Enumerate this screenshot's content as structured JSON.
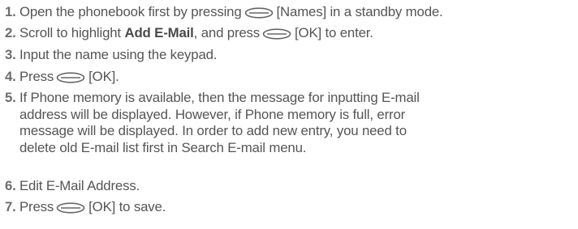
{
  "steps": [
    {
      "number": "1.",
      "before": "Open the phonebook first by pressing",
      "key_icon": "soft-key-left-icon",
      "after": "[Names] in a standby mode."
    },
    {
      "number": "2.",
      "before": "Scroll to highlight ",
      "bold": "Add E-Mail",
      "middle": ", and press",
      "key_icon": "ok-key-icon",
      "after": "[OK] to enter."
    },
    {
      "number": "3.",
      "text": "Input the name using the keypad."
    },
    {
      "number": "4.",
      "before": "Press",
      "key_icon": "ok-key-icon",
      "after": "[OK]."
    },
    {
      "number": "5.",
      "lines": [
        "If Phone memory is available, then the message for inputting E-mail",
        "address will be displayed. However, if Phone memory is full, error",
        "message will be displayed. In order to add new entry, you need to",
        "delete old E-mail list first in Search E-mail menu."
      ]
    },
    {
      "number": "6.",
      "text": "Edit E-Mail Address."
    },
    {
      "number": "7.",
      "before": "Press",
      "key_icon": "ok-key-icon",
      "after": "[OK] to save."
    }
  ]
}
